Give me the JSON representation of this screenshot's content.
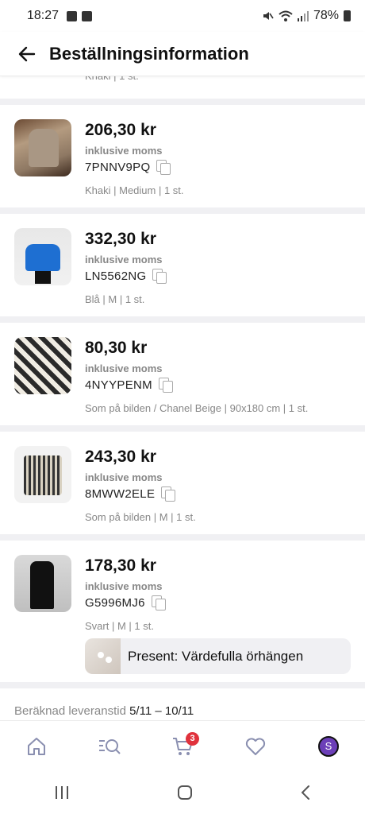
{
  "status_bar": {
    "time": "18:27",
    "battery": "78%"
  },
  "header": {
    "title": "Beställningsinformation"
  },
  "partial_item": {
    "variant": "Khaki | 1 st."
  },
  "items": [
    {
      "price": "206,30 kr",
      "vat": "inklusive moms",
      "code": "7PNNV9PQ",
      "variant": "Khaki | Medium | 1 st."
    },
    {
      "price": "332,30 kr",
      "vat": "inklusive moms",
      "code": "LN5562NG",
      "variant": "Blå | M | 1 st."
    },
    {
      "price": "80,30 kr",
      "vat": "inklusive moms",
      "code": "4NYYPENM",
      "variant": "Som på bilden / Chanel Beige | 90x180 cm | 1 st."
    },
    {
      "price": "243,30 kr",
      "vat": "inklusive moms",
      "code": "8MWW2ELE",
      "variant": "Som på bilden | M | 1 st."
    },
    {
      "price": "178,30 kr",
      "vat": "inklusive moms",
      "code": "G5996MJ6",
      "variant": "Svart | M | 1 st.",
      "gift": "Present: Värdefulla örhängen"
    }
  ],
  "delivery": {
    "label": "Beräknad leveranstid",
    "dates": "5/11 – 10/11"
  },
  "bottom_nav": {
    "cart_badge": "3",
    "avatar_letter": "S",
    "icons": [
      "home-icon",
      "search-icon",
      "cart-icon",
      "heart-icon",
      "avatar"
    ]
  },
  "colors": {
    "badge": "#e0323c",
    "avatar": "#6c3fb8",
    "separator": "#f0f0f3"
  }
}
